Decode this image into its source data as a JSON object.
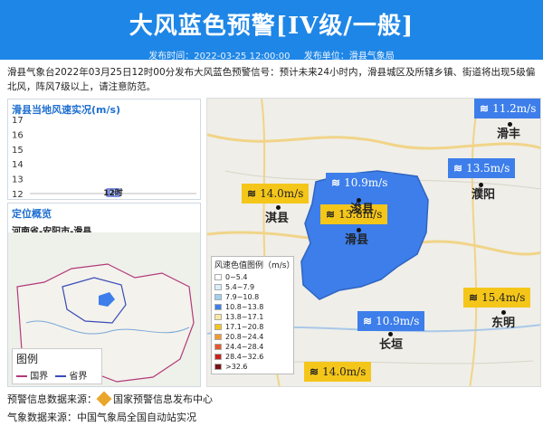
{
  "header": {
    "title": "大风蓝色预警[IV级/一般]",
    "publish_time": "发布时间：2022-03-25 12:00:00",
    "publisher": "发布单位：滑县气象局"
  },
  "description": "滑县气象台2022年03月25日12时00分发布大风蓝色预警信号：预计未来24小时内，滑县城区及所辖乡镇、街道将出现5级偏北风，阵风7级以上，请注意防范。",
  "wind_panel": {
    "title": "滑县当地风速实况(m/s)",
    "yticks": [
      "17",
      "16",
      "15",
      "14",
      "13",
      "12"
    ],
    "bar_label": "12",
    "x_label": "12时"
  },
  "chart_data": {
    "type": "bar",
    "title": "滑县当地风速实况(m/s)",
    "categories": [
      "12时"
    ],
    "values": [
      12
    ],
    "ylim": [
      12,
      17
    ]
  },
  "location_panel": {
    "title": "定位概览",
    "path": "河南省-安阳市-滑县",
    "legend_title": "图例",
    "legend_national": "国界",
    "legend_province": "省界"
  },
  "map": {
    "labels": [
      {
        "text": "11.2m/s",
        "style": "blue"
      },
      {
        "text": "14.0m/s",
        "style": "yellow"
      },
      {
        "text": "10.9m/s",
        "style": "blue"
      },
      {
        "text": "13.8m/s",
        "style": "yellow"
      },
      {
        "text": "13.5m/s",
        "style": "blue"
      },
      {
        "text": "15.4m/s",
        "style": "yellow"
      },
      {
        "text": "10.9m/s",
        "style": "blue"
      },
      {
        "text": "14.0m/s",
        "style": "yellow"
      }
    ],
    "cities": [
      "滑丰",
      "浚县",
      "淇县",
      "滑县",
      "濮阳",
      "东明",
      "长垣"
    ],
    "legend": {
      "title": "风速色值图例（m/s）",
      "items": [
        {
          "range": "0~5.4",
          "color": "#ffffff"
        },
        {
          "range": "5.4~7.9",
          "color": "#dbeefc"
        },
        {
          "range": "7.9~10.8",
          "color": "#9fcff2"
        },
        {
          "range": "10.8~13.8",
          "color": "#3d7eea"
        },
        {
          "range": "13.8~17.1",
          "color": "#fbe7a0"
        },
        {
          "range": "17.1~20.8",
          "color": "#f5c61a"
        },
        {
          "range": "20.8~24.4",
          "color": "#f39a2e"
        },
        {
          "range": "24.4~28.4",
          "color": "#e8562a"
        },
        {
          "range": "28.4~32.6",
          "color": "#c8231e"
        },
        {
          "range": ">32.6",
          "color": "#7d0f14"
        }
      ]
    }
  },
  "footer": {
    "warning_source": "预警信息数据来源：",
    "warning_source_name": "国家预警信息发布中心",
    "weather_source": "气象数据来源：中国气象局全国自动站实况"
  }
}
